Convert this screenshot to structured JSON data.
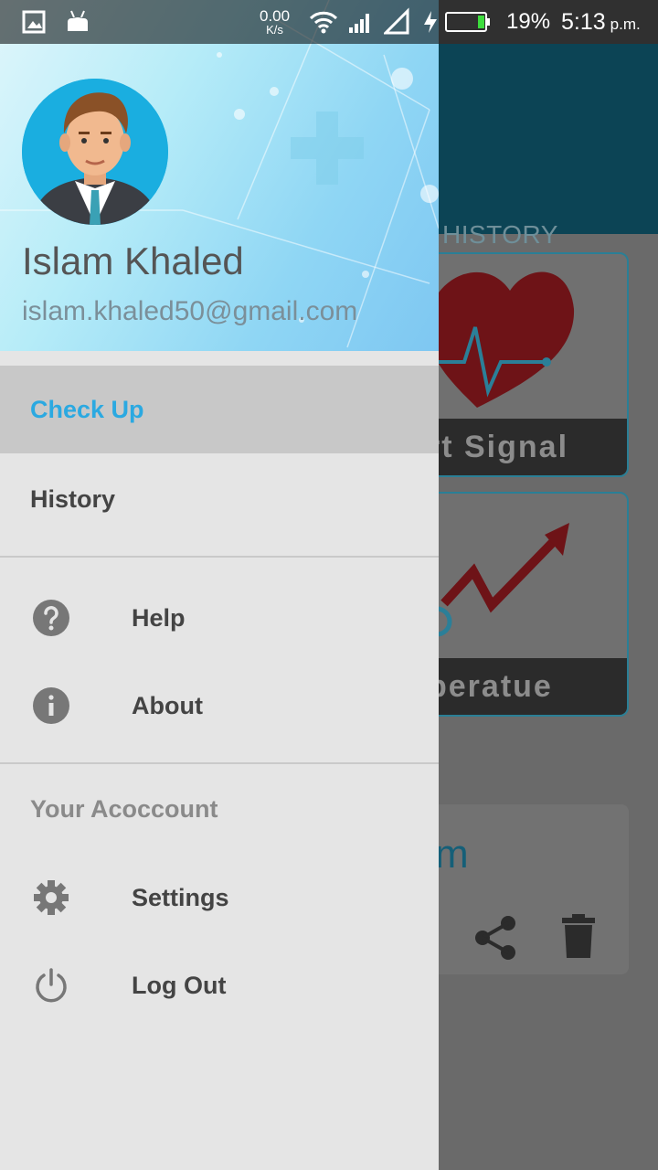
{
  "status_bar": {
    "network_speed_value": "0.00",
    "network_speed_unit": "K/s",
    "battery_percent": "19%",
    "time": "5:13",
    "ampm": "p.m."
  },
  "background_app": {
    "tab_label": "HISTORY",
    "card_heart_caption": "rt Signal",
    "card_temp_caption": "peratue",
    "message_fragment": "m"
  },
  "drawer": {
    "user_name": "Islam Khaled",
    "user_email": "islam.khaled50@gmail.com",
    "menu": {
      "checkup": "Check Up",
      "history": "History",
      "help": "Help",
      "about": "About",
      "section_account": "Your Acoccount",
      "settings": "Settings",
      "logout": "Log Out"
    }
  },
  "colors": {
    "accent": "#2ba9e1",
    "app_bar": "#0c4455",
    "drawer_bg": "#e5e5e5",
    "selected_item_bg": "#c8c8c8"
  }
}
